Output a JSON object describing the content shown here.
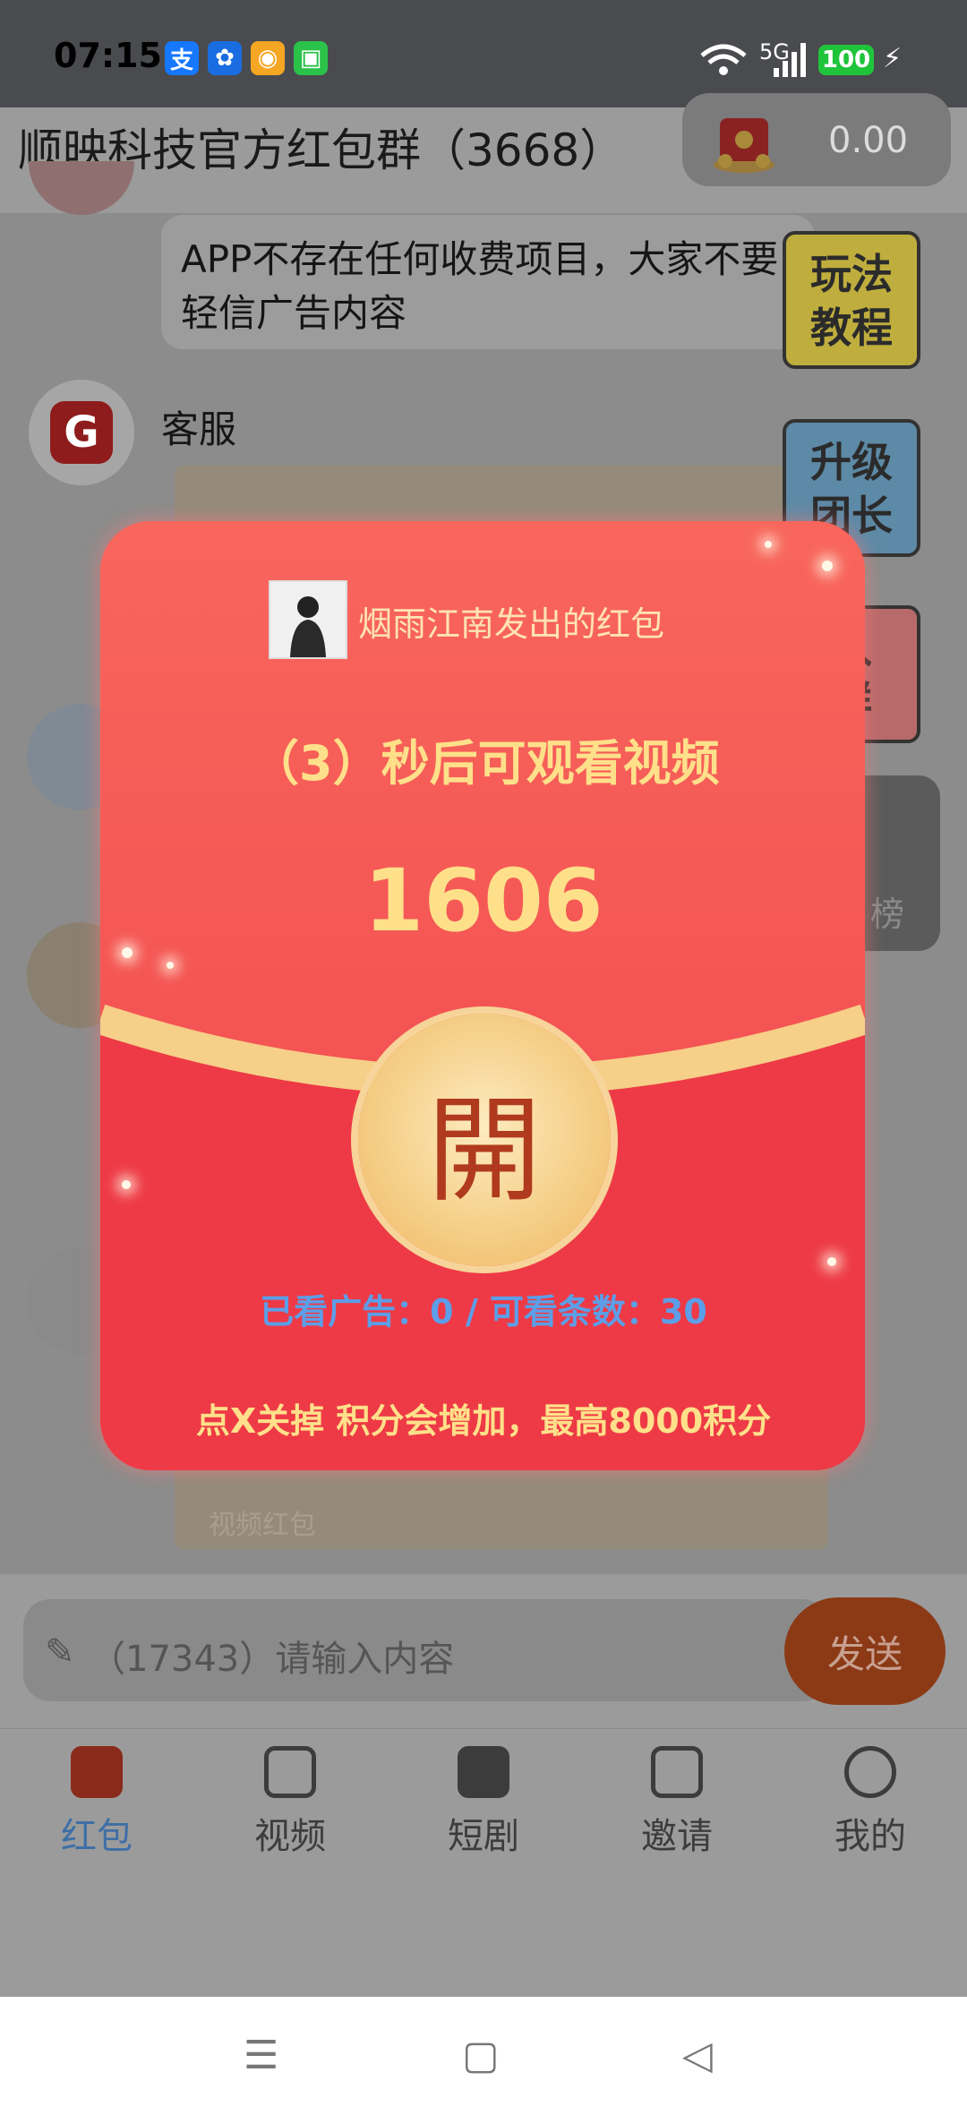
{
  "status_bar": {
    "time": "07:15",
    "apps": [
      {
        "icon": "alipay-icon",
        "glyph": "支",
        "color": "#1677ff"
      },
      {
        "icon": "pinwheel-icon",
        "glyph": "✿",
        "color": "#1a6de0"
      },
      {
        "icon": "weibo-icon",
        "glyph": "◉",
        "color": "#f5a623"
      },
      {
        "icon": "green-app-icon",
        "glyph": "▣",
        "color": "#2bc24a"
      }
    ],
    "network": "5G",
    "battery": "100"
  },
  "header": {
    "title": "顺映科技官方红包群（3668）",
    "balance": "0.00"
  },
  "chat": {
    "notice": "APP不存在任何收费项目，大家不要轻信广告内容",
    "service_name": "客服",
    "card_label": "视频红包",
    "side_buttons": [
      {
        "label_line1": "玩法",
        "label_line2": "教程",
        "color": "#c8b84a"
      },
      {
        "label_line1": "升级",
        "label_line2": "团长",
        "color": "#5d8aa6"
      },
      {
        "label_line1": "入",
        "label_line2": "群",
        "color": "#c46a6a"
      }
    ],
    "rank_label": "榜"
  },
  "red_packet": {
    "sender": "烟雨江南发出的红包",
    "countdown": "（3）秒后可观看视频",
    "amount": "1606",
    "open_label": "開",
    "stats": "已看广告：0  /  可看条数：30",
    "note": "点X关掉 积分会增加，最高8000积分",
    "colors": {
      "top": "#f55755",
      "bottom": "#ee3b45",
      "gold": "#ffe08a",
      "stats": "#5c9ee8"
    }
  },
  "input_bar": {
    "placeholder": "（17343）请输入内容",
    "send_label": "发送"
  },
  "tabs": [
    {
      "label": "红包",
      "icon": "red-packet-icon",
      "active": true
    },
    {
      "label": "视频",
      "icon": "video-icon",
      "active": false
    },
    {
      "label": "短剧",
      "icon": "tv-icon",
      "active": false
    },
    {
      "label": "邀请",
      "icon": "invite-icon",
      "active": false
    },
    {
      "label": "我的",
      "icon": "profile-icon",
      "active": false
    }
  ],
  "nav": {
    "menu": "☰",
    "home": "▢",
    "back": "◁"
  }
}
